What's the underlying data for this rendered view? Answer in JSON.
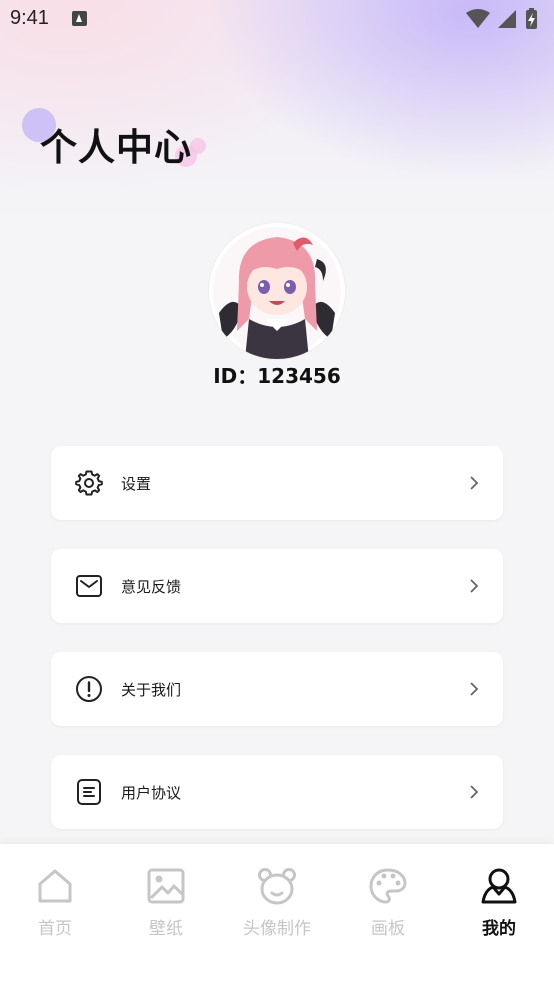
{
  "status_bar": {
    "time": "9:41"
  },
  "header": {
    "title": "个人中心"
  },
  "profile": {
    "id_text": "ID：123456"
  },
  "menu": [
    {
      "label": "设置",
      "icon": "gear-icon"
    },
    {
      "label": "意见反馈",
      "icon": "mail-icon"
    },
    {
      "label": "关于我们",
      "icon": "info-icon"
    },
    {
      "label": "用户协议",
      "icon": "document-icon"
    }
  ],
  "tabs": [
    {
      "label": "首页",
      "icon": "home-icon",
      "active": false
    },
    {
      "label": "壁纸",
      "icon": "image-icon",
      "active": false
    },
    {
      "label": "头像制作",
      "icon": "bear-icon",
      "active": false
    },
    {
      "label": "画板",
      "icon": "palette-icon",
      "active": false
    },
    {
      "label": "我的",
      "icon": "person-icon",
      "active": true
    }
  ],
  "colors": {
    "active": "#111111",
    "inactive": "#c6c6c6",
    "accent_lavender": "#c6b6f8",
    "accent_pink": "#f6c4e8"
  }
}
